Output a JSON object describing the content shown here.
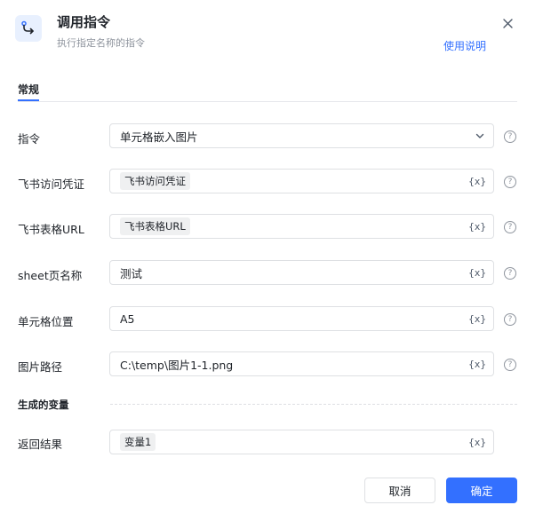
{
  "dialog": {
    "title": "调用指令",
    "subtitle": "执行指定名称的指令",
    "help_link": "使用说明",
    "header_icon": "flow-arrow-icon",
    "close_icon": "close-icon"
  },
  "tabs": [
    {
      "label": "常规",
      "active": true
    }
  ],
  "fields": {
    "command": {
      "label": "指令",
      "value": "单元格嵌入图片"
    },
    "credential": {
      "label": "飞书访问凭证",
      "value": "飞书访问凭证"
    },
    "sheet_url": {
      "label": "飞书表格URL",
      "value": "飞书表格URL"
    },
    "sheet_name": {
      "label": "sheet页名称",
      "value": "测试"
    },
    "cell_position": {
      "label": "单元格位置",
      "value": "A5"
    },
    "image_path": {
      "label": "图片路径",
      "value": "C:\\temp\\图片1-1.png"
    }
  },
  "output": {
    "section_title": "生成的变量",
    "return_result": {
      "label": "返回结果",
      "value": "变量1"
    }
  },
  "variable_marker": "{x}",
  "help_marker": "?",
  "buttons": {
    "cancel": "取消",
    "ok": "确定"
  },
  "colors": {
    "accent": "#3370ff",
    "border": "#dee0e3",
    "muted_text": "#8f959e"
  }
}
